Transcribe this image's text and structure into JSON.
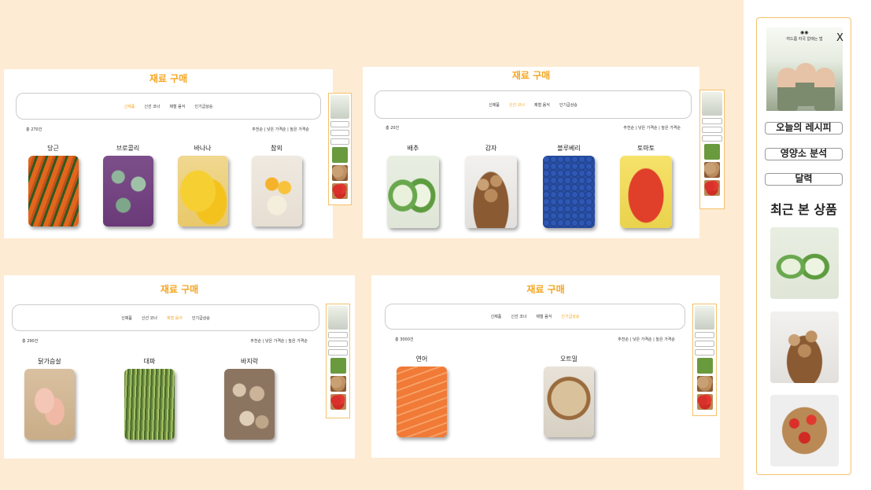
{
  "page_title": "재료 구매",
  "tabs": [
    "신제품",
    "신선 코너",
    "제철 음식",
    "인기급상승"
  ],
  "sort_text": "추천순 | 낮은 가격순 | 높은 가격순",
  "panels": [
    {
      "count": "총 270건",
      "active_tab": "신제품",
      "items": [
        "당근",
        "브로콜리",
        "바나나",
        "참외"
      ]
    },
    {
      "count": "총 20건",
      "active_tab": "신선 코너",
      "items": [
        "배추",
        "감자",
        "블루베리",
        "토마토"
      ]
    },
    {
      "count": "총 290건",
      "active_tab": "제철 음식",
      "items": [
        "닭가슴살",
        "대파",
        "바지락"
      ]
    },
    {
      "count": "총 3000건",
      "active_tab": "인기급상승",
      "items": [
        "연어",
        "오트밀"
      ]
    }
  ],
  "sidebar": {
    "ad_title": "여드름 자국 없애는 법",
    "ad_close": "X",
    "buttons": [
      "오늘의 레시피",
      "영양소 분석",
      "달력"
    ],
    "recent_title": "최근 본 상품",
    "recent_items": [
      "cabbage",
      "potato",
      "strawberry"
    ]
  },
  "colors": {
    "accent": "#f5a623",
    "background": "#fdebd3",
    "sidebar_border": "#f5c26b"
  }
}
